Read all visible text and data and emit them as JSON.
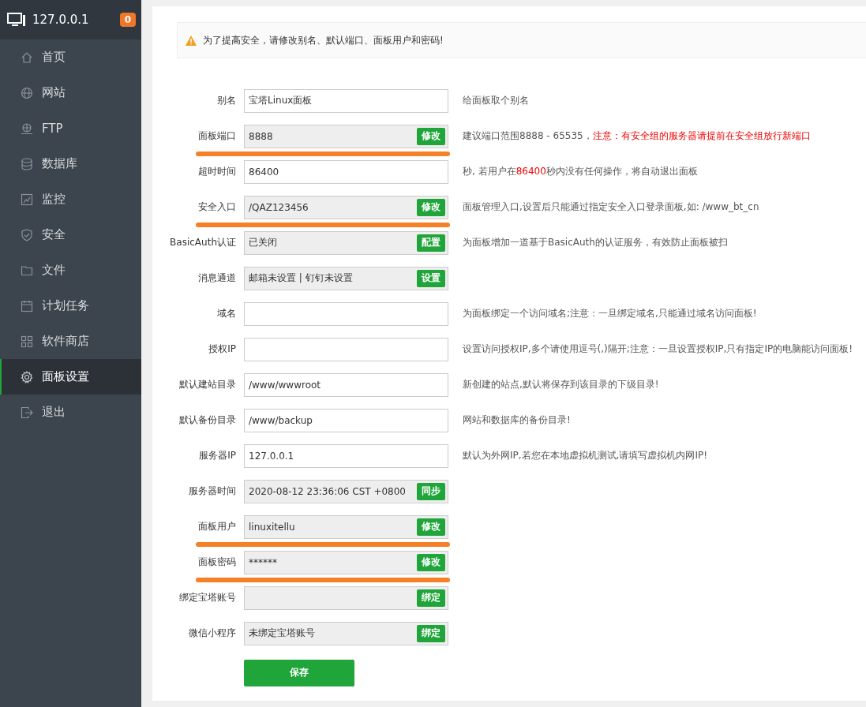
{
  "sidebar": {
    "host": "127.0.0.1",
    "badge": "0",
    "items": [
      {
        "label": "首页",
        "kind": "home",
        "selected": false
      },
      {
        "label": "网站",
        "kind": "globe",
        "selected": false
      },
      {
        "label": "FTP",
        "kind": "ftp",
        "selected": false
      },
      {
        "label": "数据库",
        "kind": "database",
        "selected": false
      },
      {
        "label": "监控",
        "kind": "monitor",
        "selected": false
      },
      {
        "label": "安全",
        "kind": "shield",
        "selected": false
      },
      {
        "label": "文件",
        "kind": "folder",
        "selected": false
      },
      {
        "label": "计划任务",
        "kind": "calendar",
        "selected": false
      },
      {
        "label": "软件商店",
        "kind": "grid",
        "selected": false
      },
      {
        "label": "面板设置",
        "kind": "gear",
        "selected": true
      },
      {
        "label": "退出",
        "kind": "exit",
        "selected": false
      }
    ]
  },
  "alert": "为了提高安全，请修改别名、默认端口、面板用户和密码!",
  "form": [
    {
      "label": "别名",
      "kind": "input",
      "value": "宝塔Linux面板",
      "underlined": false,
      "hint": [
        {
          "text": "给面板取个别名",
          "highlight": false
        }
      ]
    },
    {
      "label": "面板端口",
      "kind": "readonly",
      "value": "8888",
      "button": "修改",
      "underlined": true,
      "hint": [
        {
          "text": "建议端口范围8888 - 65535，",
          "highlight": false
        },
        {
          "text": "注意：有安全组的服务器请提前在安全组放行新端口",
          "highlight": true
        }
      ]
    },
    {
      "label": "超时时间",
      "kind": "input",
      "value": "86400",
      "underlined": false,
      "hint": [
        {
          "text": "秒, 若用户在",
          "highlight": false
        },
        {
          "text": "86400",
          "highlight": true
        },
        {
          "text": "秒内没有任何操作，将自动退出面板",
          "highlight": false
        }
      ]
    },
    {
      "label": "安全入口",
      "kind": "readonly",
      "value": "/QAZ123456",
      "button": "修改",
      "underlined": true,
      "hint": [
        {
          "text": "面板管理入口,设置后只能通过指定安全入口登录面板,如: /www_bt_cn",
          "highlight": false
        }
      ]
    },
    {
      "label": "BasicAuth认证",
      "kind": "readonly",
      "value": "已关闭",
      "button": "配置",
      "underlined": false,
      "hint": [
        {
          "text": "为面板增加一道基于BasicAuth的认证服务，有效防止面板被扫",
          "highlight": false
        }
      ]
    },
    {
      "label": "消息通道",
      "kind": "readonly",
      "value": "邮箱未设置 | 钉钉未设置",
      "button": "设置",
      "underlined": false
    },
    {
      "label": "域名",
      "kind": "input",
      "underlined": false,
      "hint": [
        {
          "text": "为面板绑定一个访问域名;注意：一旦绑定域名,只能通过域名访问面板!",
          "highlight": false
        }
      ]
    },
    {
      "label": "授权IP",
      "kind": "input",
      "underlined": false,
      "hint": [
        {
          "text": "设置访问授权IP,多个请使用逗号(,)隔开;注意：一旦设置授权IP,只有指定IP的电脑能访问面板!",
          "highlight": false
        }
      ]
    },
    {
      "label": "默认建站目录",
      "kind": "input",
      "value": "/www/wwwroot",
      "underlined": false,
      "hint": [
        {
          "text": "新创建的站点,默认将保存到该目录的下级目录!",
          "highlight": false
        }
      ]
    },
    {
      "label": "默认备份目录",
      "kind": "input",
      "value": "/www/backup",
      "underlined": false,
      "hint": [
        {
          "text": "网站和数据库的备份目录!",
          "highlight": false
        }
      ]
    },
    {
      "label": "服务器IP",
      "kind": "input",
      "value": "127.0.0.1",
      "underlined": false,
      "hint": [
        {
          "text": "默认为外网IP,若您在本地虚拟机测试,请填写虚拟机内网IP!",
          "highlight": false
        }
      ]
    },
    {
      "label": "服务器时间",
      "kind": "readonly",
      "value": "2020-08-12 23:36:06 CST +0800",
      "button": "同步",
      "underlined": false
    },
    {
      "label": "面板用户",
      "kind": "readonly",
      "value": "linuxitellu",
      "button": "修改",
      "underlined": true
    },
    {
      "label": "面板密码",
      "kind": "readonly",
      "value": "******",
      "button": "修改",
      "underlined": true
    },
    {
      "label": "绑定宝塔账号",
      "kind": "readonly",
      "button": "绑定",
      "underlined": false
    },
    {
      "label": "微信小程序",
      "kind": "readonly",
      "value": "未绑定宝塔账号",
      "button": "绑定",
      "underlined": false
    }
  ],
  "save_button": "保存"
}
